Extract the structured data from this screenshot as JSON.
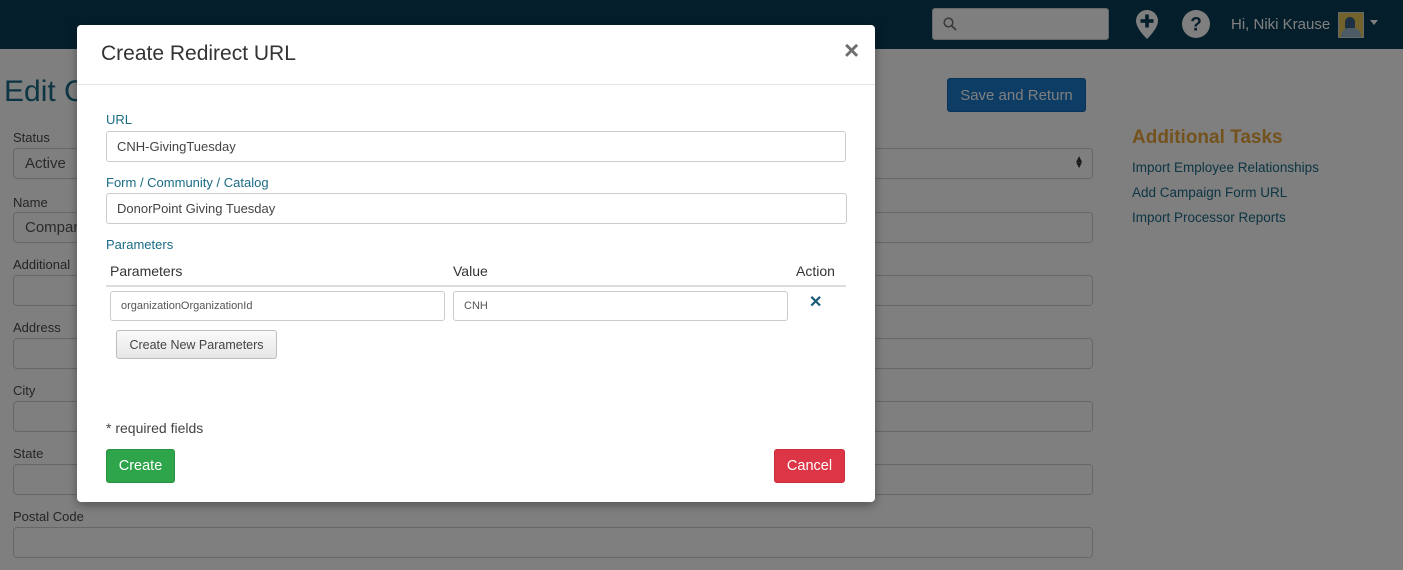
{
  "header": {
    "search": {
      "value": "",
      "placeholder": ""
    },
    "icons": [
      "search-icon",
      "add-location-icon",
      "help-icon",
      "chevron-down-icon"
    ],
    "greeting": "Hi, Niki Krause"
  },
  "page": {
    "title": "Edit C",
    "save_return_label": "Save and Return",
    "fields": [
      {
        "label": "Status",
        "value": "Active"
      },
      {
        "label": "Name",
        "value": "Compan"
      },
      {
        "label": "Additional",
        "value": ""
      },
      {
        "label": "Address",
        "value": ""
      },
      {
        "label": "City",
        "value": ""
      },
      {
        "label": "State",
        "value": ""
      },
      {
        "label": "Postal Code",
        "value": ""
      }
    ],
    "tasks": {
      "title": "Additional Tasks",
      "links": [
        "Import Employee Relationships",
        "Add Campaign Form URL",
        "Import Processor Reports"
      ]
    }
  },
  "modal": {
    "title": "Create Redirect URL",
    "url_label": "URL",
    "url_value": "CNH-GivingTuesday",
    "form_label": "Form / Community / Catalog",
    "form_value": "DonorPoint Giving Tuesday",
    "parameters_label": "Parameters",
    "table": {
      "headers": [
        "Parameters",
        "Value",
        "Action"
      ],
      "rows": [
        {
          "parameter": "organizationOrganizationId",
          "value": "CNH"
        }
      ]
    },
    "new_params_label": "Create New Parameters",
    "required_note": "* required fields",
    "create_label": "Create",
    "cancel_label": "Cancel"
  },
  "colors": {
    "topbar": "#0a3d56",
    "link": "#1a6b86",
    "tasks_title": "#e6a53a",
    "primary": "#1b78c8",
    "success": "#2ea54a",
    "danger": "#dc3545"
  }
}
